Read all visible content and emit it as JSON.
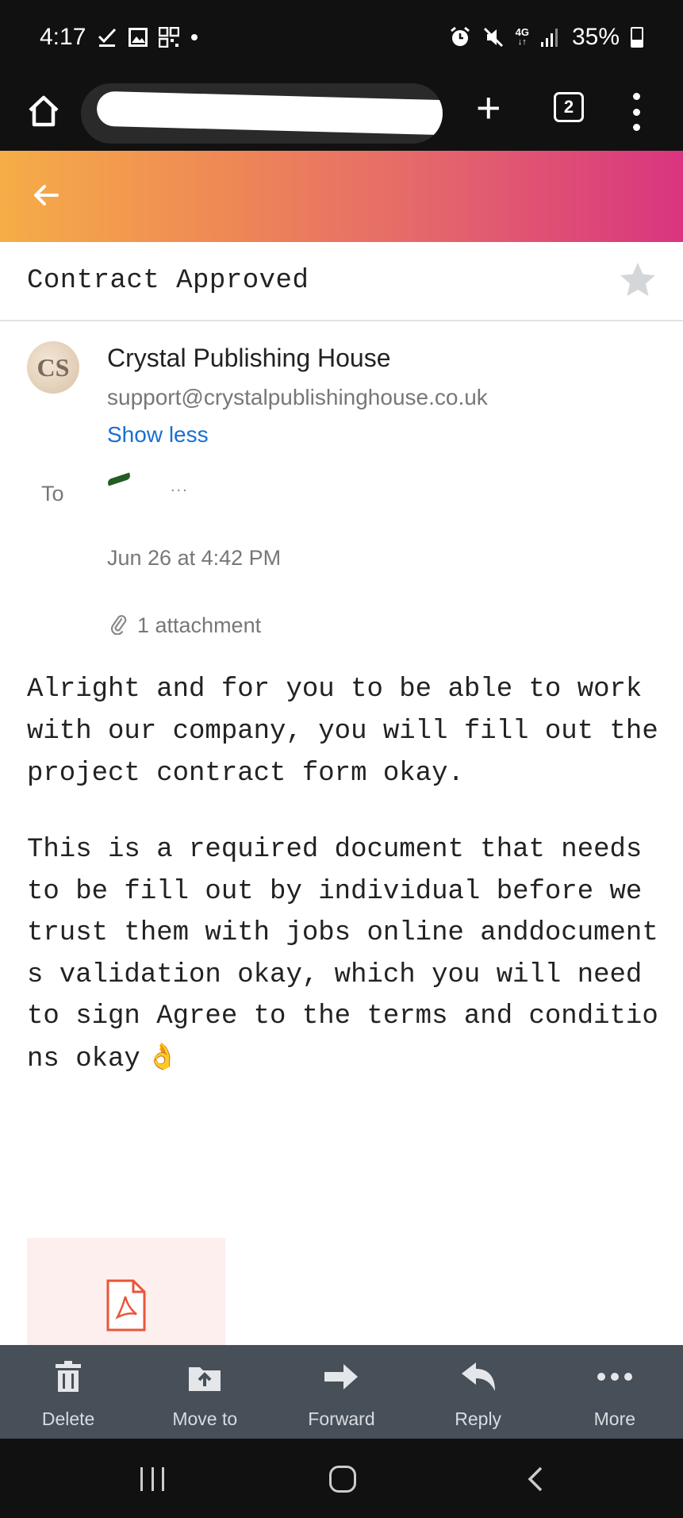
{
  "status_bar": {
    "time": "4:17",
    "network": "4G",
    "battery": "35%",
    "icons": [
      "check-icon",
      "image-icon",
      "qr-icon",
      "dot-icon",
      "alarm-icon",
      "mute-icon",
      "network-4g-icon",
      "signal-icon",
      "battery-icon"
    ]
  },
  "browser": {
    "tab_count": "2",
    "icons": [
      "home-icon",
      "lock-icon",
      "plus-icon",
      "tabs-icon",
      "menu-dots-icon"
    ]
  },
  "email": {
    "subject": "Contract Approved",
    "sender_initials": "CS",
    "sender_name": "Crystal Publishing House",
    "sender_email": "support@crystalpublishinghouse.co.uk",
    "show_less": "Show less",
    "to_label": "To",
    "to_tail": "...",
    "date": "Jun 26 at 4:42 PM",
    "attachments": "1 attachment",
    "body_para1": "Alright and for you to be able to work with our company, you will fill out the project contract form okay.",
    "body_para2": "This is a required document that needs to be fill out by individual before we trust them with jobs online anddocuments validation okay, which you will need to sign Agree to the terms and conditions okay",
    "emoji": "👌"
  },
  "actions": [
    {
      "label": "Delete",
      "icon": "trash-icon"
    },
    {
      "label": "Move to",
      "icon": "move-to-icon"
    },
    {
      "label": "Forward",
      "icon": "forward-icon"
    },
    {
      "label": "Reply",
      "icon": "reply-icon"
    },
    {
      "label": "More",
      "icon": "more-icon"
    }
  ],
  "colors": {
    "header_gradient_start": "#f6ad47",
    "header_gradient_end": "#d9357f",
    "link": "#1a6fd1",
    "action_bar": "#474f58"
  }
}
